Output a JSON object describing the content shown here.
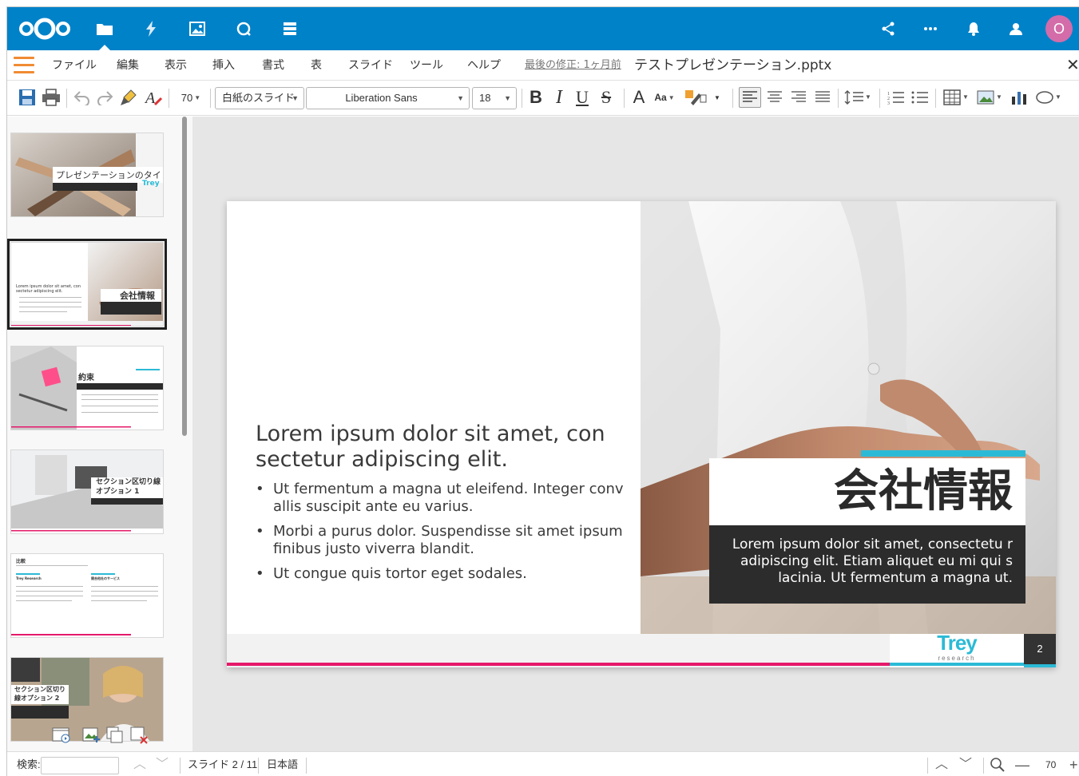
{
  "topbar": {
    "apps": [
      "files-icon",
      "activity-icon",
      "photos-icon",
      "search-icon",
      "deck-icon"
    ],
    "right_icons": [
      "share-icon",
      "more-icon",
      "notifications-icon",
      "contacts-icon"
    ],
    "avatar_initial": "O",
    "brand_color": "#0082c9"
  },
  "menubar": {
    "items": [
      "ファイル",
      "編集",
      "表示",
      "挿入",
      "書式",
      "表",
      "スライド",
      "ツール",
      "ヘルプ"
    ],
    "last_modified": "最後の修正: 1ヶ月前",
    "doc_title": "テストプレゼンテーション.pptx",
    "close": "✕"
  },
  "toolbar": {
    "zoom": "70",
    "layout": "白紙のスライド",
    "font": "Liberation Sans",
    "font_size": "18",
    "bold": "B",
    "italic": "I",
    "underline": "U",
    "strike": "S",
    "font_color": "A",
    "case": "Aa"
  },
  "sidebar": {
    "thumbs": [
      {
        "title": "プレゼンテーションのタイトル",
        "sub": "Trey"
      },
      {
        "title": "会社情報"
      },
      {
        "title": "約束"
      },
      {
        "title": "セクション区切り線オプション 1"
      },
      {
        "title": "比較",
        "col1": "Trey Research",
        "col2": "競合他社のサービス"
      },
      {
        "title": "セクション区切り線オプション 2"
      }
    ]
  },
  "slide": {
    "heading": "Lorem ipsum dolor sit amet, con sectetur adipiscing elit.",
    "bullets": [
      "Ut fermentum a magna ut eleifend. Integer conv allis suscipit ante eu varius.",
      "Morbi a purus dolor. Suspendisse sit amet ipsum finibus justo viverra blandit.",
      "Ut congue quis tortor eget sodales."
    ],
    "title": "会社情報",
    "description": "Lorem ipsum dolor sit amet, consectetu r adipiscing elit. Etiam aliquet eu mi qui s lacinia. Ut fermentum a magna ut.",
    "brand": "Trey",
    "brand_sub": "research",
    "page_number": "2",
    "accent_pink": "#e5196a",
    "accent_cyan": "#2bbad6"
  },
  "statusbar": {
    "search_label": "検索:",
    "slide_info": "スライド 2 / 11",
    "language": "日本語",
    "zoom": "70"
  }
}
